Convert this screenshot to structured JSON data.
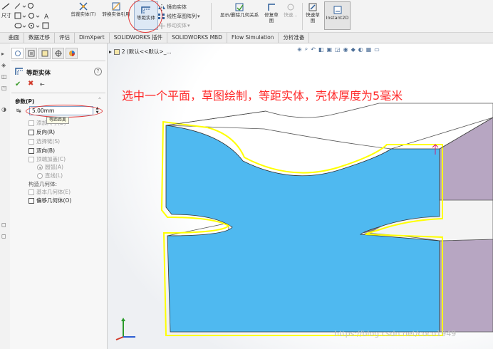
{
  "ribbon": {
    "sketch_cmd_partial": "尺寸",
    "trim_label": "剪裁实体(T)",
    "convert_label": "转换实体引用",
    "offset_label": "等距实体",
    "mirror_label": "镜向实体",
    "linear_pattern_label": "线性草图阵列",
    "move_label": "移动实体",
    "relations_label": "显示/删除几何关系",
    "repair_label": "修复草图",
    "quick_snaps_label": "快速...",
    "quick_sketch_label": "快速草图",
    "instant2d_label": "Instant2D"
  },
  "tabs": [
    "曲面",
    "数据迁移",
    "评估",
    "DimXpert",
    "SOLIDWORKS 插件",
    "SOLIDWORKS MBD",
    "Flow Simulation",
    "分析准备"
  ],
  "property_manager": {
    "title": "等距实体",
    "help_icon": "?",
    "group_title": "参数(P)",
    "distance_value": "5.00mm",
    "distance_tooltip": "等距距离",
    "options": [
      {
        "label": "添加尺寸(D)",
        "checked": true,
        "disabled": true
      },
      {
        "label": "反向(R)",
        "checked": false,
        "disabled": false
      },
      {
        "label": "选择链(S)",
        "checked": false,
        "disabled": true
      },
      {
        "label": "双向(B)",
        "checked": false,
        "disabled": false
      },
      {
        "label": "顶端加盖(C)",
        "checked": false,
        "disabled": true
      }
    ],
    "cap_options": [
      {
        "label": "圆弧(A)",
        "selected": true
      },
      {
        "label": "直线(L)",
        "selected": false
      }
    ],
    "construction_label": "构造几何体:",
    "construction_options": [
      {
        "label": "基本几何体(E)",
        "checked": false,
        "disabled": true
      },
      {
        "label": "偏移几何体(O)",
        "checked": false,
        "disabled": false
      }
    ]
  },
  "graphics": {
    "feature_tree_label": "2 (默认<<默认>_...",
    "annotation": "选中一个平面，草图绘制，等距实体，壳体厚度为5毫米",
    "watermark": "https://blog.csdn.net/coco1949"
  },
  "colors": {
    "selected_face": "#4fb9f0",
    "offset_sketch": "#ffff00",
    "side_face": "#b7a6c2",
    "top_face": "#ffffff",
    "annotation": "#ff2a2a"
  }
}
